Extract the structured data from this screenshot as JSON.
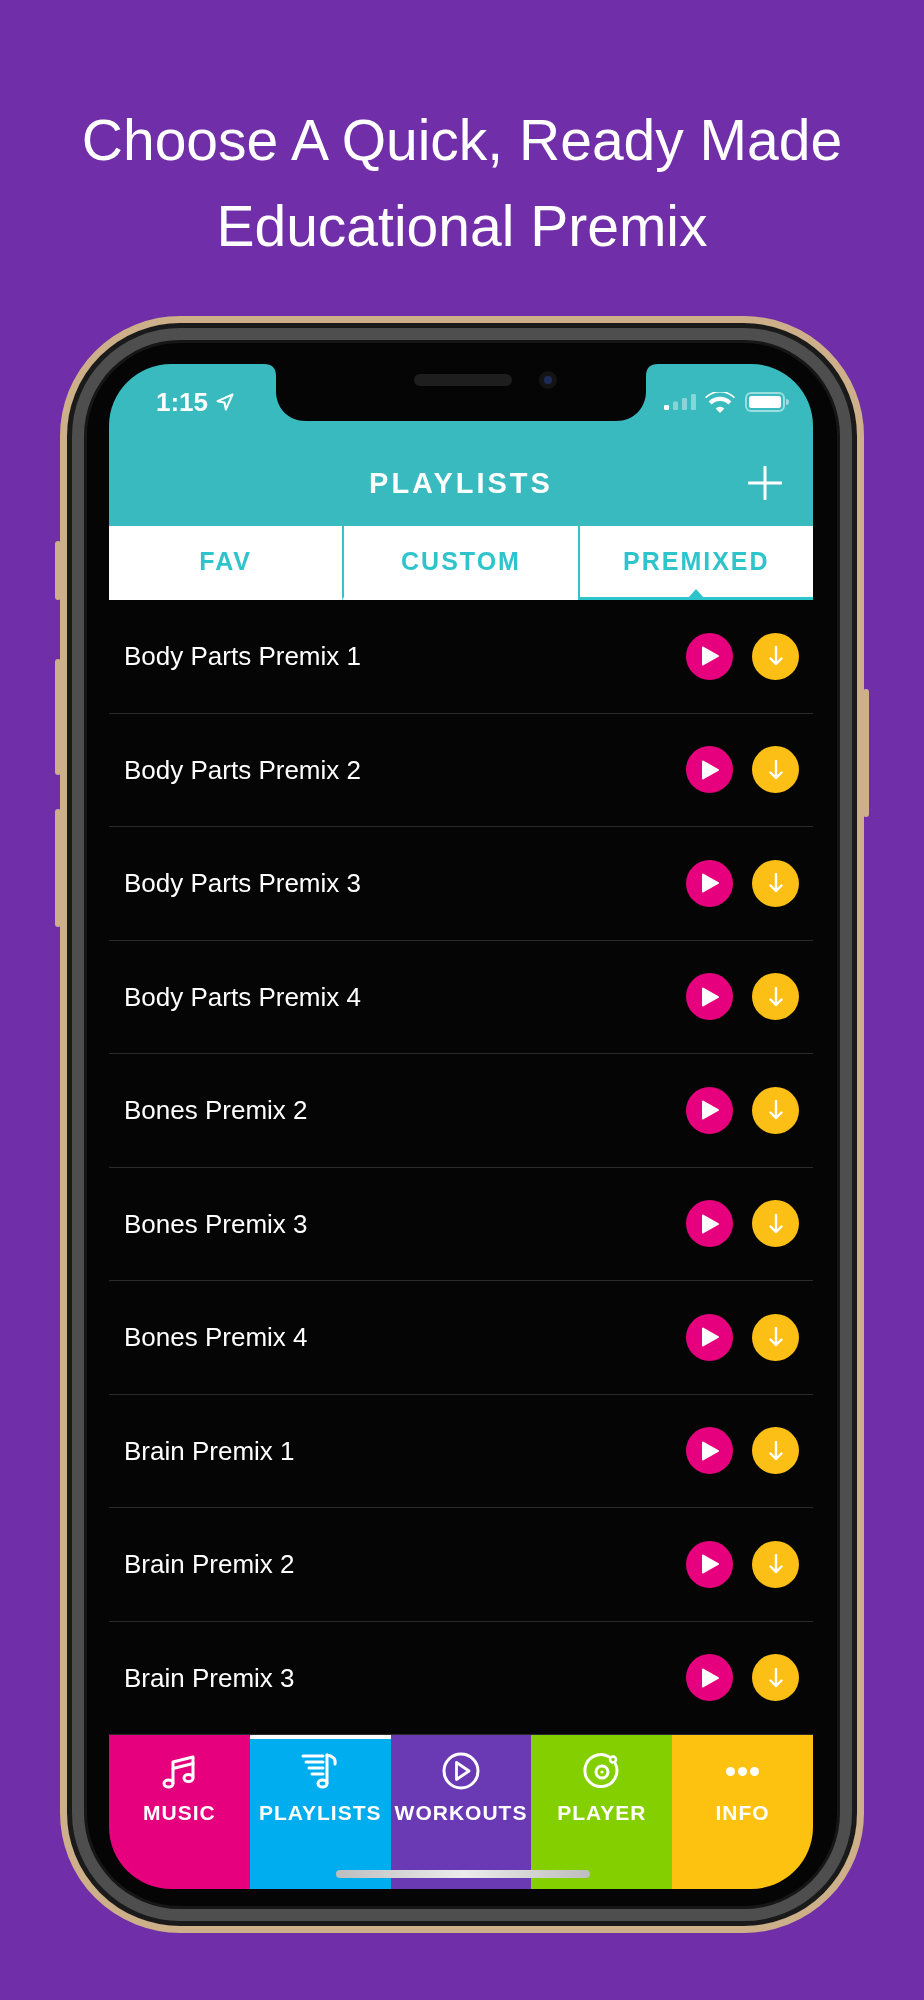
{
  "headline": "Choose A Quick, Ready Made Educational Premix",
  "status_bar": {
    "time": "1:15"
  },
  "header": {
    "title": "PLAYLISTS"
  },
  "tabs": [
    {
      "label": "FAV",
      "selected": false
    },
    {
      "label": "CUSTOM",
      "selected": false
    },
    {
      "label": "PREMIXED",
      "selected": true
    }
  ],
  "playlists": [
    {
      "name": "Body Parts Premix 1"
    },
    {
      "name": "Body Parts Premix 2"
    },
    {
      "name": "Body Parts Premix 3"
    },
    {
      "name": "Body Parts Premix 4"
    },
    {
      "name": "Bones Premix 2"
    },
    {
      "name": "Bones Premix 3"
    },
    {
      "name": "Bones Premix 4"
    },
    {
      "name": "Brain Premix 1"
    },
    {
      "name": "Brain Premix 2"
    },
    {
      "name": "Brain Premix 3"
    }
  ],
  "bottom_nav": [
    {
      "label": "MUSIC",
      "kind": "music",
      "color": "#e6007e",
      "selected": false
    },
    {
      "label": "PLAYLISTS",
      "kind": "playlists",
      "color": "#00adef",
      "selected": true
    },
    {
      "label": "WORKOUTS",
      "kind": "workouts",
      "color": "#6a3ab5",
      "selected": false
    },
    {
      "label": "PLAYER",
      "kind": "player",
      "color": "#84cf00",
      "selected": false
    },
    {
      "label": "INFO",
      "kind": "info",
      "color": "#fdc10f",
      "selected": false
    }
  ]
}
